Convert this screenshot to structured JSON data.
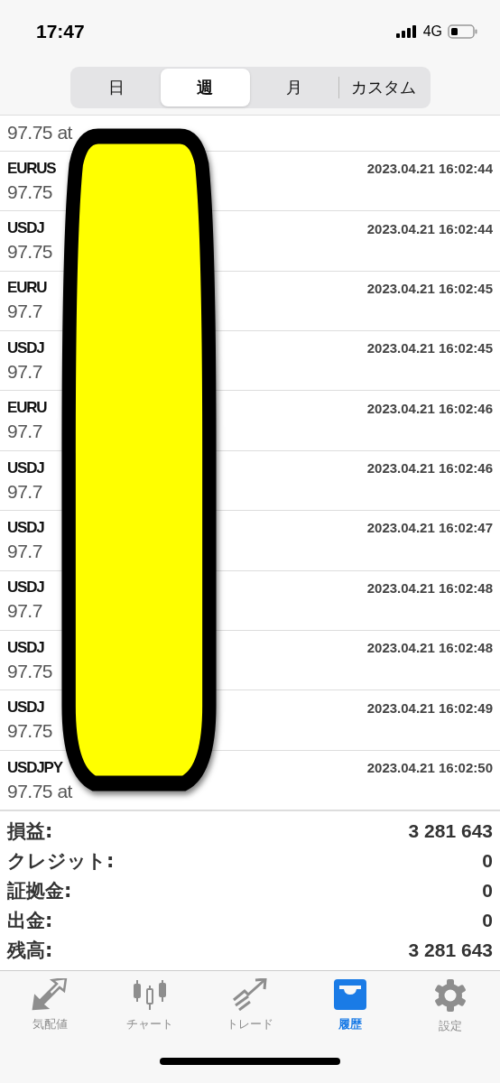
{
  "status_bar": {
    "time": "17:47",
    "network": "4G"
  },
  "period_tabs": [
    {
      "label": "日",
      "selected": false
    },
    {
      "label": "週",
      "selected": true
    },
    {
      "label": "月",
      "selected": false
    },
    {
      "label": "カスタム",
      "selected": false
    }
  ],
  "history": [
    {
      "detail": "97.75 at"
    },
    {
      "symbol": "EURUS",
      "time": "2023.04.21 16:02:44",
      "detail": "97.75"
    },
    {
      "symbol": "USDJ",
      "time": "2023.04.21 16:02:44",
      "detail": "97.75"
    },
    {
      "symbol": "EURU",
      "time": "2023.04.21 16:02:45",
      "detail": "97.7"
    },
    {
      "symbol": "USDJ",
      "time": "2023.04.21 16:02:45",
      "detail": "97.7"
    },
    {
      "symbol": "EURU",
      "time": "2023.04.21 16:02:46",
      "detail": "97.7"
    },
    {
      "symbol": "USDJ",
      "time": "2023.04.21 16:02:46",
      "detail": "97.7"
    },
    {
      "symbol": "USDJ",
      "time": "2023.04.21 16:02:47",
      "detail": "97.7"
    },
    {
      "symbol": "USDJ",
      "time": "2023.04.21 16:02:48",
      "detail": "97.7"
    },
    {
      "symbol": "USDJ",
      "time": "2023.04.21 16:02:48",
      "detail": "97.75"
    },
    {
      "symbol": "USDJ",
      "time": "2023.04.21 16:02:49",
      "detail": "97.75"
    },
    {
      "symbol": "USDJPY",
      "time": "2023.04.21 16:02:50",
      "detail": "97.75 at"
    }
  ],
  "summary": [
    {
      "label": "損益:",
      "value": "3 281 643"
    },
    {
      "label": "クレジット:",
      "value": "0"
    },
    {
      "label": "証拠金:",
      "value": "0"
    },
    {
      "label": "出金:",
      "value": "0"
    },
    {
      "label": "残高:",
      "value": "3 281 643"
    }
  ],
  "tab_bar": [
    {
      "kind": "quotes",
      "label": "気配値",
      "selected": false
    },
    {
      "kind": "chart",
      "label": "チャート",
      "selected": false
    },
    {
      "kind": "trade",
      "label": "トレード",
      "selected": false
    },
    {
      "kind": "history",
      "label": "履歴",
      "selected": true
    },
    {
      "kind": "settings",
      "label": "設定",
      "selected": false
    }
  ]
}
